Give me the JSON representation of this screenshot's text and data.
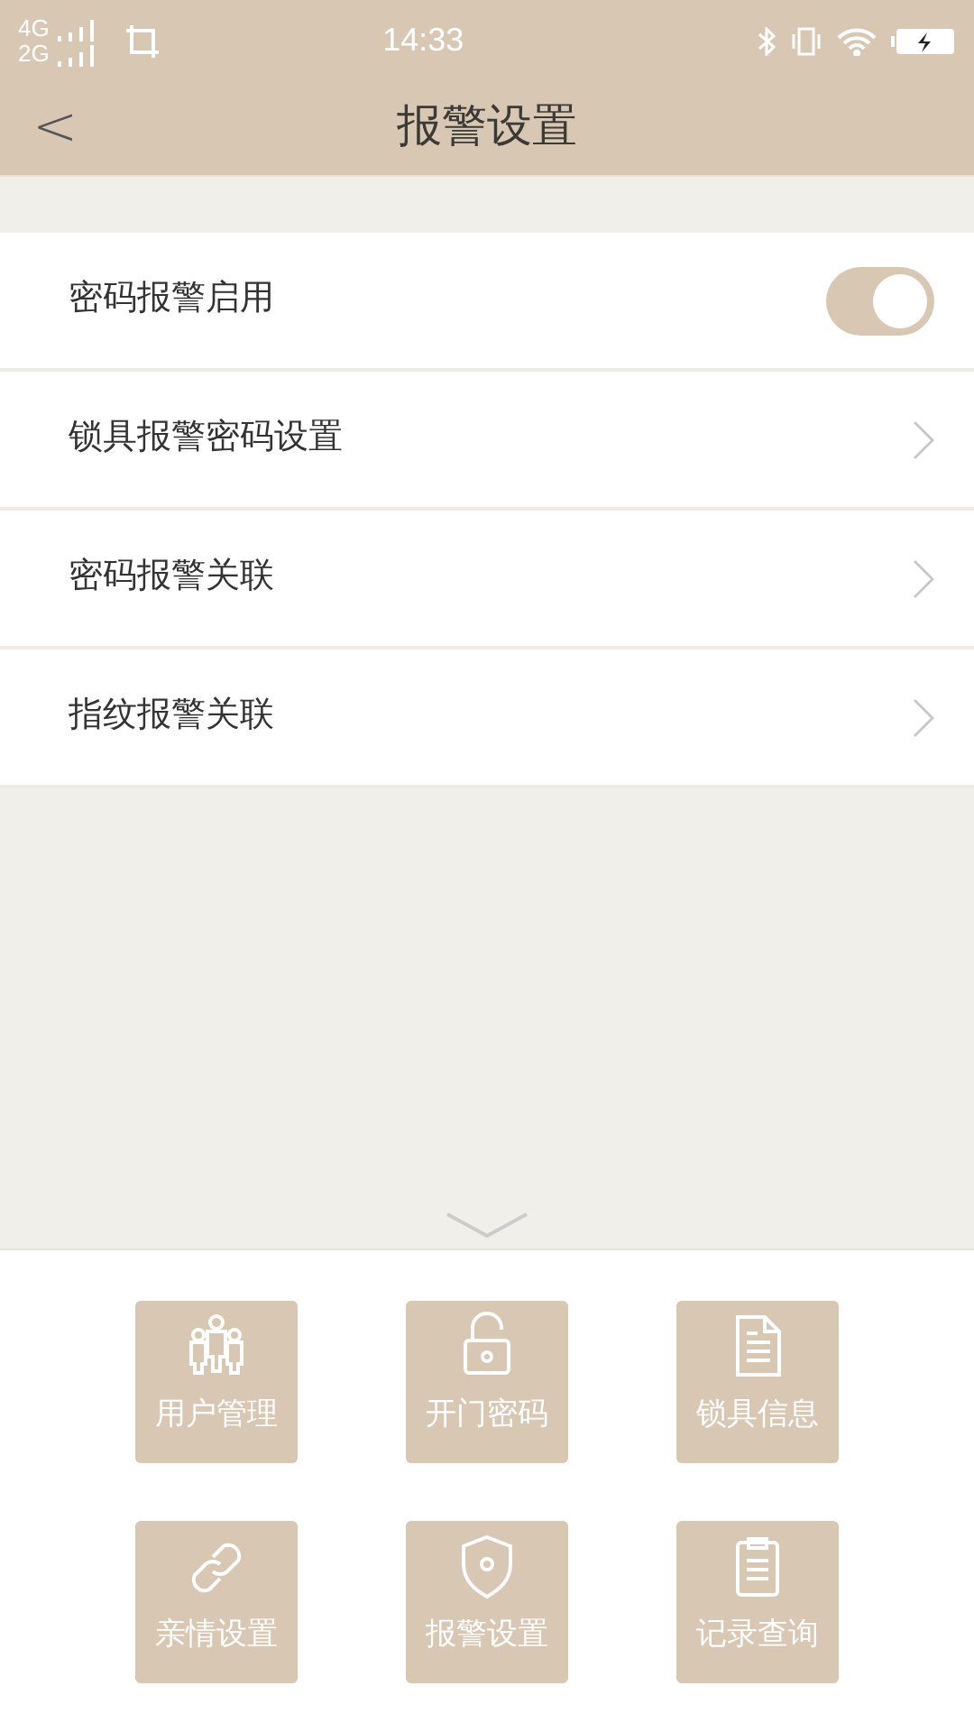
{
  "status_bar": {
    "network_1": "4G",
    "network_2": "2G",
    "time": "14:33"
  },
  "header": {
    "back": "<",
    "title": "报警设置"
  },
  "settings": [
    {
      "kind": "toggle",
      "label": "密码报警启用",
      "on": true
    },
    {
      "kind": "link",
      "label": "锁具报警密码设置"
    },
    {
      "kind": "link",
      "label": "密码报警关联"
    },
    {
      "kind": "link",
      "label": "指纹报警关联"
    }
  ],
  "menu": [
    {
      "label": "用户管理"
    },
    {
      "label": "开门密码"
    },
    {
      "label": "锁具信息"
    },
    {
      "label": "亲情设置"
    },
    {
      "label": "报警设置"
    },
    {
      "label": "记录查询"
    }
  ]
}
